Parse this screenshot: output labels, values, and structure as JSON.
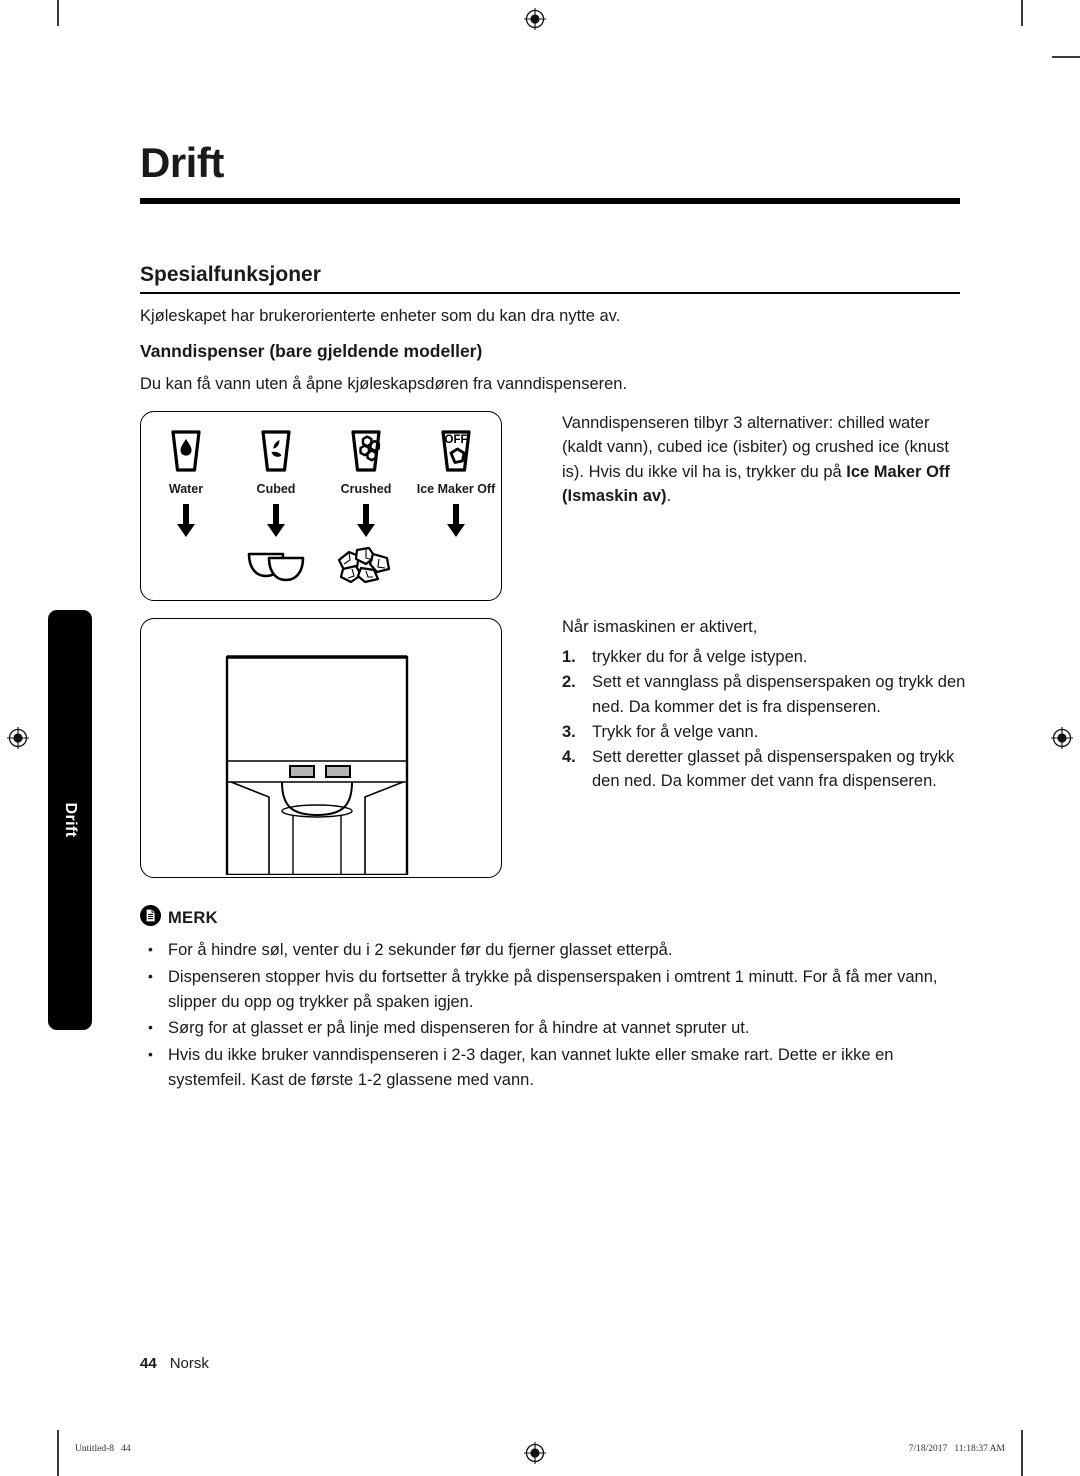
{
  "side_tab": {
    "label": "Drift"
  },
  "chapter": {
    "title": "Drift"
  },
  "section": {
    "title": "Spesialfunksjoner",
    "intro": "Kjøleskapet har brukerorienterte enheter som du kan dra nytte av."
  },
  "subsection": {
    "title": "Vanndispenser (bare gjeldende modeller)",
    "text": "Du kan få vann uten å åpne kjøleskapsdøren fra vanndispenseren."
  },
  "figure_icons": {
    "columns": [
      {
        "label": "Water",
        "icon": "glass-water-drop-icon",
        "arrow": "down-arrow-icon",
        "output": "none"
      },
      {
        "label": "Cubed",
        "icon": "glass-cubed-ice-icon",
        "arrow": "down-arrow-icon",
        "output": "cubed-ice-icon"
      },
      {
        "label": "Crushed",
        "icon": "glass-crushed-ice-icon",
        "arrow": "down-arrow-icon",
        "output": "crushed-ice-icon"
      },
      {
        "label": "Ice Maker Off",
        "icon": "glass-ice-maker-off-icon",
        "arrow": "down-arrow-icon",
        "output": "none",
        "badge": "OFF"
      }
    ]
  },
  "figure_dispenser": {
    "caption": "",
    "icon": "dispenser-front-view"
  },
  "right_column": {
    "paragraph_parts": [
      "Vanndispenseren tilbyr 3 alternativer: chilled water (kaldt vann), cubed ice (isbiter) og crushed ice (knust is). Hvis du ikke vil ha is, trykker du på ",
      "Ice Maker Off (Ismaskin av)",
      "."
    ],
    "lead": "Når ismaskinen er aktivert,",
    "steps": [
      {
        "num": "1.",
        "text": "trykker du for å velge istypen."
      },
      {
        "num": "2.",
        "text": "Sett et vannglass på dispenserspaken og trykk den ned. Da kommer det is fra dispenseren."
      },
      {
        "num": "3.",
        "text": "Trykk for å velge vann."
      },
      {
        "num": "4.",
        "text": "Sett deretter glasset på dispenserspaken og trykk den ned. Da kommer det vann fra dispenseren."
      }
    ]
  },
  "note": {
    "icon": "note-document-icon",
    "title": "MERK",
    "bullet": "•",
    "items": [
      "For å hindre søl, venter du i 2 sekunder før du fjerner glasset etterpå.",
      "Dispenseren stopper hvis du fortsetter å trykke på dispenserspaken i omtrent 1 minutt. For å få mer vann, slipper du opp og trykker på spaken igjen.",
      "Sørg for at glasset er på linje med dispenseren for å hindre at vannet spruter ut.",
      "Hvis du ikke bruker vanndispenseren i 2-3 dager, kan vannet lukte eller smake rart. Dette er ikke en systemfeil. Kast de første 1-2 glassene med vann."
    ]
  },
  "footer": {
    "page_number": "44",
    "language": "Norsk",
    "print_left": "Untitled-8   44",
    "print_right": "7/18/2017   11:18:37 AM"
  },
  "colors": {
    "ink": "#1a1a1a",
    "rule": "#000000",
    "tab_bg": "#000000",
    "tab_text": "#ffffff",
    "button_fill": "#b3b3b3"
  }
}
